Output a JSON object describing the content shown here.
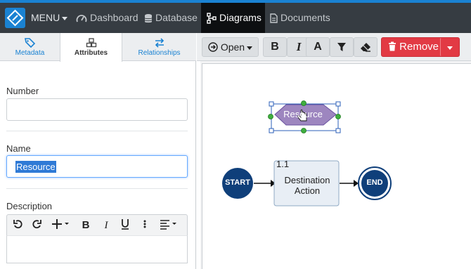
{
  "nav": {
    "menu": "MENU",
    "dashboard": "Dashboard",
    "database": "Database",
    "diagrams": "Diagrams",
    "documents": "Documents"
  },
  "tabs": {
    "metadata": "Metadata",
    "attributes": "Attributes",
    "relationships": "Relationships"
  },
  "form": {
    "number_label": "Number",
    "number_value": "",
    "name_label": "Name",
    "name_value": "Resource",
    "description_label": "Description"
  },
  "toolbar": {
    "open": "Open",
    "bold": "B",
    "italic": "I",
    "font": "A",
    "remove": "Remove"
  },
  "diagram": {
    "resource_label": "Resource",
    "start_label": "START",
    "end_label": "END",
    "action_id": "1.1",
    "action_label_line1": "Destination",
    "action_label_line2": "Action"
  },
  "colors": {
    "accent": "#1a82d2",
    "navbar": "#363c42",
    "danger": "#e23a44",
    "resource_shape": "#9d86bf",
    "terminal_node": "#0f3f7a"
  }
}
